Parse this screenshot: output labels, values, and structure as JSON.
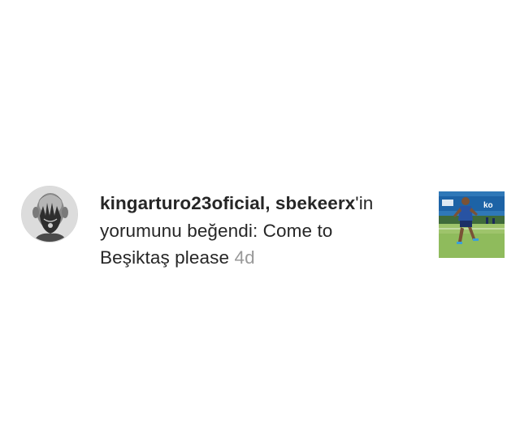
{
  "notification": {
    "user1": "kingarturo23oficial",
    "separator": ", ",
    "user2": "sbekeerx",
    "suffix": "'in",
    "line2": "yorumunu beğendi: Come to",
    "line3": "Beşiktaş please",
    "time": "4d"
  },
  "avatar": {
    "icon": "profile-picture-tattooed-hand"
  },
  "thumbnail": {
    "icon": "post-photo-player-on-pitch",
    "banner_text": "ko"
  },
  "colors": {
    "text": "#262626",
    "muted": "#999999",
    "background": "#ffffff"
  }
}
